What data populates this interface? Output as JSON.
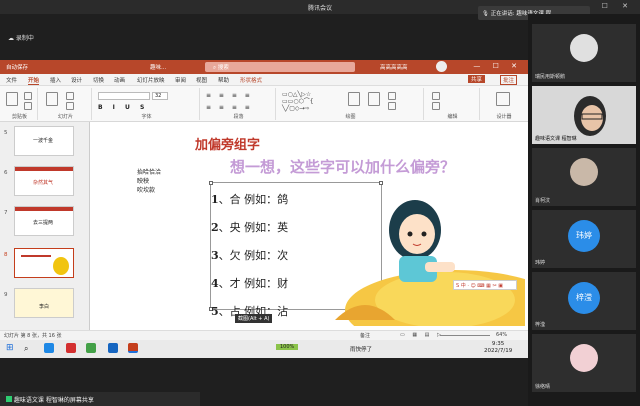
{
  "meeting": {
    "title": "腾讯会议",
    "speaking": "正在讲话: 趣味语文课 程...",
    "recording": "录制中",
    "share_banner": "趣味语文课 程智琳的屏幕共享"
  },
  "ppt": {
    "autosave": "自动保存",
    "filename": "趣味...",
    "search_placeholder": "搜索",
    "user": "高高高高高",
    "share": "共享",
    "comment": "批注",
    "menu": [
      "文件",
      "开始",
      "插入",
      "设计",
      "切换",
      "动画",
      "幻灯片放映",
      "审阅",
      "视图",
      "帮助",
      "形状格式"
    ],
    "ribbon_groups": [
      "剪贴板",
      "幻灯片",
      "字体",
      "段落",
      "绘图",
      "编辑",
      "设计器"
    ],
    "font_size": "32",
    "thumb_numbers": [
      "5",
      "6",
      "7",
      "8",
      "9"
    ],
    "thumb_titles": [
      "一波千金",
      "杂然其气",
      "去三提两",
      "",
      "李白"
    ],
    "status_left": "幻灯片 第 8 张，共 16 张",
    "status_notes": "备注",
    "zoom": "64%"
  },
  "slide": {
    "title": "加偏旁组字",
    "question": "想一想，这些字可以加什么偏旁？",
    "left_notes": [
      "抬哈恰洽",
      "映秧",
      "吹坎款"
    ],
    "items": [
      {
        "num": "1",
        "text": "、合  例如：鸽"
      },
      {
        "num": "2",
        "text": "、央  例如：英"
      },
      {
        "num": "3",
        "text": "、欠  例如：次"
      },
      {
        "num": "4",
        "text": "、才  例如：财"
      },
      {
        "num": "5",
        "text": "、占  例如：沾"
      }
    ],
    "screenshot_hint": "截图(Alt + A)"
  },
  "taskbar": {
    "time": "9:35",
    "date": "2022/7/19",
    "weather": "雨快停了",
    "battery": "100%"
  },
  "participants": [
    {
      "name": "瑞民用斯顿鹅",
      "type": "avatar"
    },
    {
      "name": "趣味语文课 程智琳",
      "type": "video"
    },
    {
      "name": "肖柯汶",
      "type": "avatar"
    },
    {
      "name": "玮婷",
      "badge": "玮婷",
      "type": "badge"
    },
    {
      "name": "梓滢",
      "badge": "梓滢",
      "type": "badge"
    },
    {
      "name": "徐络晴",
      "type": "avatar"
    }
  ],
  "colors": {
    "accent": "#b7472a",
    "slide_title": "#c0392b",
    "question": "#c49bd6"
  }
}
